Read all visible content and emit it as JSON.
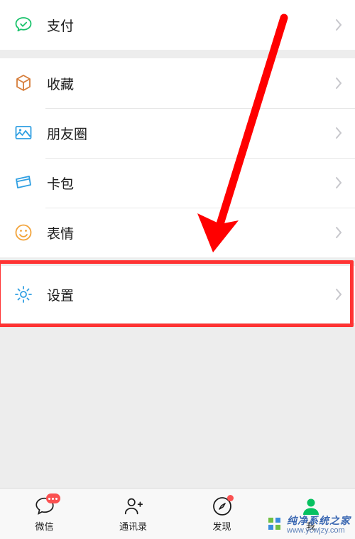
{
  "sections": [
    {
      "items": [
        {
          "key": "pay",
          "label": "支付",
          "icon": "wechat-pay-icon",
          "color": "#19c26b"
        }
      ]
    },
    {
      "items": [
        {
          "key": "fav",
          "label": "收藏",
          "icon": "cube-icon",
          "color": "#d67d3a"
        },
        {
          "key": "moments",
          "label": "朋友圈",
          "icon": "image-icon",
          "color": "#2f9fe2"
        },
        {
          "key": "cards",
          "label": "卡包",
          "icon": "card-icon",
          "color": "#2f9fe2"
        },
        {
          "key": "sticker",
          "label": "表情",
          "icon": "smile-icon",
          "color": "#f2a33a"
        }
      ]
    },
    {
      "items": [
        {
          "key": "settings",
          "label": "设置",
          "icon": "gear-icon",
          "color": "#2f9fe2"
        }
      ]
    }
  ],
  "highlight_key": "settings",
  "arrow_color": "#ff0000",
  "highlight_color": "#ff3333",
  "tabs": [
    {
      "key": "chat",
      "label": "微信",
      "icon": "chat-bubble-icon",
      "badge": true
    },
    {
      "key": "contacts",
      "label": "通讯录",
      "icon": "contacts-icon",
      "badge": false
    },
    {
      "key": "discover",
      "label": "发现",
      "icon": "compass-icon",
      "badge": "dot"
    },
    {
      "key": "me",
      "label": "我",
      "icon": "person-icon",
      "badge": false,
      "active": true
    }
  ],
  "watermark": {
    "title": "纯净系统之家",
    "url": "www.ycwjzy.com"
  }
}
